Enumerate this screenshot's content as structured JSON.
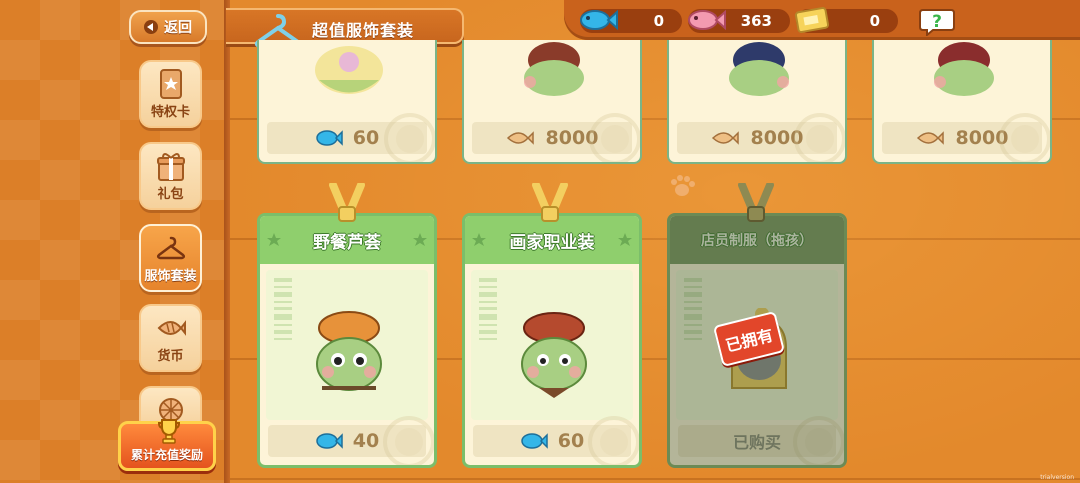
{
  "header": {
    "back_label": "返回",
    "title": "超值服饰套装"
  },
  "currencies": [
    {
      "name": "blue-fish",
      "value": "0",
      "color": "#34b6e8"
    },
    {
      "name": "pink-fish",
      "value": "363",
      "color": "#f08aa0"
    },
    {
      "name": "ticket",
      "value": "0",
      "color": "#f3c64a"
    }
  ],
  "help_label": "?",
  "sidebar": {
    "items": [
      {
        "label": "特权卡",
        "icon": "privilege-card-icon"
      },
      {
        "label": "礼包",
        "icon": "gift-box-icon"
      },
      {
        "label": "服饰套装",
        "icon": "hanger-icon",
        "active": true
      },
      {
        "label": "货币",
        "icon": "fish-cake-icon"
      },
      {
        "label": "",
        "icon": "flower-icon"
      }
    ],
    "reward_label": "累计充值奖励"
  },
  "top_cards": [
    {
      "price": "60",
      "currency": "fish"
    },
    {
      "price": "8000",
      "currency": "fish-cake"
    },
    {
      "price": "8000",
      "currency": "fish-cake"
    },
    {
      "price": "8000",
      "currency": "fish-cake"
    }
  ],
  "outfit_cards": [
    {
      "title": "野餐芦荟",
      "price": "40",
      "currency": "fish",
      "owned": false
    },
    {
      "title": "画家职业装",
      "price": "60",
      "currency": "fish",
      "owned": false
    },
    {
      "title": "店员制服（拖孩）",
      "price": "已购买",
      "currency": "",
      "owned": true
    }
  ],
  "owned_tag": "已拥有",
  "colors": {
    "accent_orange": "#e3892c",
    "card_green": "#8fcf6d",
    "card_bg": "#fdf4d8",
    "owned_red": "#e2462a"
  },
  "watermark": "trialversion"
}
